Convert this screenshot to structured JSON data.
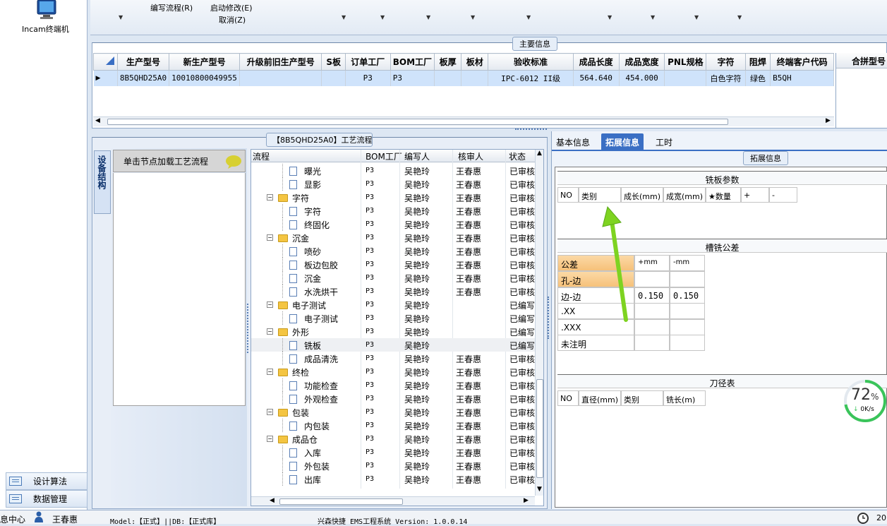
{
  "left_nav": {
    "terminal_label": "Incam终端机",
    "bottom_items": [
      {
        "label": "设计算法"
      },
      {
        "label": "数据管理"
      }
    ]
  },
  "ribbon": {
    "item_1": "编写流程(R)",
    "item_2": "启动修改(E)",
    "item_3": "取消(Z)"
  },
  "main_info": {
    "title": "主要信息",
    "columns": [
      "生产型号",
      "新生产型号",
      "升级前旧生产型号",
      "S板",
      "订单工厂",
      "BOM工厂",
      "板厚",
      "板材",
      "验收标准",
      "成品长度",
      "成品宽度",
      "PNL规格",
      "字符",
      "阻焊",
      "终端客户代码"
    ],
    "row": [
      "8B5QHD25A0",
      "10010800049955",
      "",
      "",
      "P3",
      "P3",
      "",
      "",
      "IPC-6012 II级",
      "564.640",
      "454.000",
      "",
      "白色字符",
      "绿色",
      "B5QH"
    ],
    "side_header": "合拼型号"
  },
  "flow_panel": {
    "title": "【8B5QHD25A0】工艺流程",
    "vertical_tab": "设备结构",
    "note": "单击节点加载工艺流程",
    "columns": [
      "流程",
      "BOM工厂",
      "编写人",
      "核审人",
      "状态"
    ],
    "rows": [
      {
        "name": "曝光",
        "bom": "P3",
        "author": "吴艳玲",
        "reviewer": "王春惠",
        "status": "已审核"
      },
      {
        "name": "显影",
        "bom": "P3",
        "author": "吴艳玲",
        "reviewer": "王春惠",
        "status": "已审核"
      },
      {
        "name": "字符",
        "bom": "P3",
        "author": "吴艳玲",
        "reviewer": "王春惠",
        "status": "已审核"
      },
      {
        "name": "字符",
        "bom": "P3",
        "author": "吴艳玲",
        "reviewer": "王春惠",
        "status": "已审核"
      },
      {
        "name": "终固化",
        "bom": "P3",
        "author": "吴艳玲",
        "reviewer": "王春惠",
        "status": "已审核"
      },
      {
        "name": "沉金",
        "bom": "P3",
        "author": "吴艳玲",
        "reviewer": "王春惠",
        "status": "已审核"
      },
      {
        "name": "喷砂",
        "bom": "P3",
        "author": "吴艳玲",
        "reviewer": "王春惠",
        "status": "已审核"
      },
      {
        "name": "板边包胶",
        "bom": "P3",
        "author": "吴艳玲",
        "reviewer": "王春惠",
        "status": "已审核"
      },
      {
        "name": "沉金",
        "bom": "P3",
        "author": "吴艳玲",
        "reviewer": "王春惠",
        "status": "已审核"
      },
      {
        "name": "水洗烘干",
        "bom": "P3",
        "author": "吴艳玲",
        "reviewer": "王春惠",
        "status": "已审核"
      },
      {
        "name": "电子测试",
        "bom": "P3",
        "author": "吴艳玲",
        "reviewer": "",
        "status": "已编写"
      },
      {
        "name": "电子测试",
        "bom": "P3",
        "author": "吴艳玲",
        "reviewer": "",
        "status": "已编写"
      },
      {
        "name": "外形",
        "bom": "P3",
        "author": "吴艳玲",
        "reviewer": "",
        "status": "已编写"
      },
      {
        "name": "铣板",
        "bom": "P3",
        "author": "吴艳玲",
        "reviewer": "",
        "status": "已编写"
      },
      {
        "name": "成品清洗",
        "bom": "P3",
        "author": "吴艳玲",
        "reviewer": "王春惠",
        "status": "已审核"
      },
      {
        "name": "终检",
        "bom": "P3",
        "author": "吴艳玲",
        "reviewer": "王春惠",
        "status": "已审核"
      },
      {
        "name": "功能检查",
        "bom": "P3",
        "author": "吴艳玲",
        "reviewer": "王春惠",
        "status": "已审核"
      },
      {
        "name": "外观检查",
        "bom": "P3",
        "author": "吴艳玲",
        "reviewer": "王春惠",
        "status": "已审核"
      },
      {
        "name": "包装",
        "bom": "P3",
        "author": "吴艳玲",
        "reviewer": "王春惠",
        "status": "已审核"
      },
      {
        "name": "内包装",
        "bom": "P3",
        "author": "吴艳玲",
        "reviewer": "王春惠",
        "status": "已审核"
      },
      {
        "name": "成品仓",
        "bom": "P3",
        "author": "吴艳玲",
        "reviewer": "王春惠",
        "status": "已审核"
      },
      {
        "name": "入库",
        "bom": "P3",
        "author": "吴艳玲",
        "reviewer": "王春惠",
        "status": "已审核"
      },
      {
        "name": "外包装",
        "bom": "P3",
        "author": "吴艳玲",
        "reviewer": "王春惠",
        "status": "已审核"
      },
      {
        "name": "出库",
        "bom": "P3",
        "author": "吴艳玲",
        "reviewer": "王春惠",
        "status": "已审核"
      }
    ]
  },
  "detail": {
    "tabs": [
      "基本信息",
      "拓展信息",
      "工时"
    ],
    "title": "拓展信息",
    "mill_params": {
      "title": "铣板参数",
      "columns": [
        "NO",
        "类别",
        "成长(mm)",
        "成宽(mm)",
        "★数量",
        "+",
        "-"
      ]
    },
    "slot_tol": {
      "title": "槽铣公差",
      "header": [
        "公差",
        "+mm",
        "-mm"
      ],
      "rows": [
        [
          "孔-边",
          "",
          ""
        ],
        [
          "边-边",
          "0.150",
          "0.150"
        ],
        [
          ".XX",
          "",
          ""
        ],
        [
          ".XXX",
          "",
          ""
        ],
        [
          "未注明",
          "",
          ""
        ]
      ]
    },
    "tool_table": {
      "title": "刀径表",
      "columns": [
        "NO",
        "直径(mm)",
        "类别",
        "铣长(m)"
      ]
    }
  },
  "widget": {
    "percent": "72",
    "percent_sign": "%",
    "speed": "0K/s",
    "value": 0.72
  },
  "status_bar": {
    "left": "息中心",
    "user": "王春惠",
    "model": "Model:【正式】||DB:【正式库】",
    "app": "兴森快捷 EMS工程系统 Version: 1.0.0.14",
    "right": "20"
  },
  "colors": {
    "selected_row": "#cfe3fb",
    "tab_active": "#3a6fc4",
    "arrow": "#7ed321",
    "tol_header": "#f6c17a"
  }
}
